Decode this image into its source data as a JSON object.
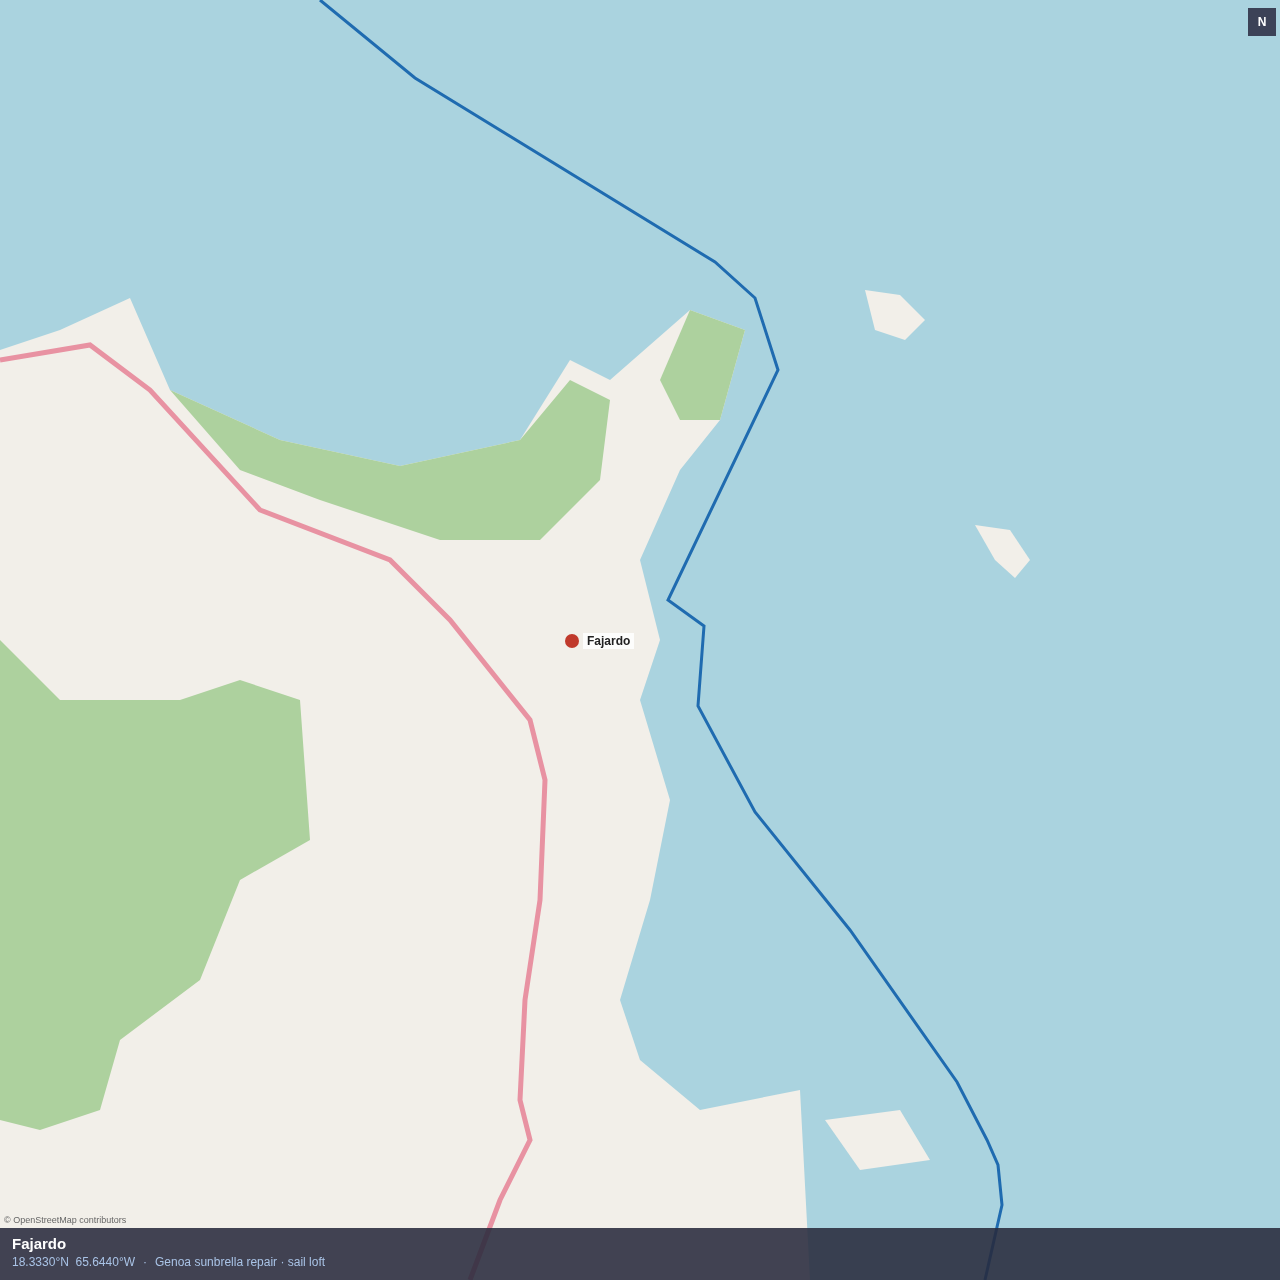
{
  "map": {
    "compass": "N",
    "marker": {
      "label": "Fajardo"
    },
    "attribution": "© OpenStreetMap contributors"
  },
  "info_bar": {
    "title": "Fajardo",
    "coordinates": "18.3330°N  65.6440°W",
    "separator": "·",
    "description": "Genoa sunbrella repair · sail loft"
  }
}
